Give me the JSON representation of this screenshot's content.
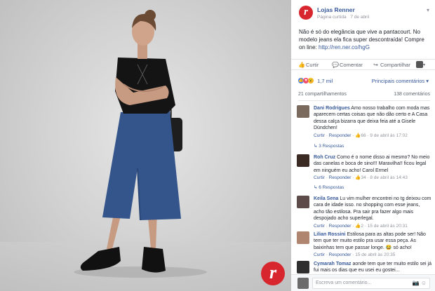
{
  "post": {
    "page_name": "Lojas Renner",
    "page_avatar_letter": "r",
    "meta_type": "Página curtida",
    "meta_date": "7 de abril",
    "text": "Não é só do elegância que vive a pantacourt. No modelo jeans ela fica super descontraída! Compre on line:",
    "link": "http://ren.ner.co/hgG"
  },
  "actions": {
    "like": "Curtir",
    "comment": "Comentar",
    "share": "Compartilhar"
  },
  "reactions": {
    "count": "1,7 mil",
    "relevant": "Principais comentários ▾",
    "shares": "21 compartilhamentos",
    "comments": "138 comentários"
  },
  "comments": [
    {
      "name": "Dani Rodrigues",
      "text": "Amo nosso trabalho com moda mas aparecem certas coisas que não dão certo e A Casa dessa calça bizarra que deixa feia até a Gisele Dündchen!",
      "reply_label": "Responder",
      "likes": "66",
      "date": "9 de abril às 17:02",
      "replies": "3 Respostas"
    },
    {
      "name": "Roh Cruz",
      "text": "Como é o nome disso ai mesmo? No meio das canelas e boca de sino!!! Maravilha!! ficou legal em ninguém eu acho! Carol Ermel",
      "reply_label": "Responder",
      "likes": "34",
      "date": "8 de abril às 14:43",
      "replies": "6 Respostas"
    },
    {
      "name": "Keila Sena",
      "text": "Lu vim mulher encontrei no tg deixou com cara de idade isso. no shopping com esse jeans, acho tão estilosa. Pra sair pra fazer algo mais despojado acho superlegal.",
      "reply_label": "Responder",
      "likes": "2",
      "date": "15 de abril às 20:31",
      "replies": ""
    },
    {
      "name": "Lilian Rossini",
      "text": "Estilosa para as altas pode ser! Não tem que ter muito estilo pra usar essa peça. As baixinhas tem que passar longe. 😂 só acho!",
      "reply_label": "Responder",
      "likes": "",
      "date": "15 de abril às 20:35",
      "replies": ""
    },
    {
      "name": "Cymarah Tomaz",
      "text": "aonde tem que ter muito estilo sei já fui mais os dias que eu usei eu gostei...",
      "reply_label": "Responder",
      "likes": "",
      "date": "",
      "replies": ""
    }
  ],
  "write_comment": {
    "placeholder": "Escreva um comentário..."
  },
  "icons": {
    "like": "thumbs-up-icon",
    "comment": "speech-bubble-icon",
    "share": "share-arrow-icon",
    "camera": "camera-icon",
    "emoji": "smiley-icon"
  },
  "colors": {
    "brand_red": "#d8262e",
    "link_blue": "#365899",
    "meta_gray": "#90949c"
  }
}
